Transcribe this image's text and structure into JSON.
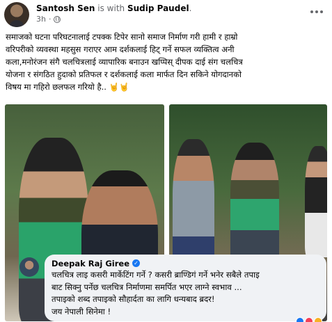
{
  "post": {
    "author": "Santosh Sen",
    "with_text": " is with ",
    "tagged": "Sudip Paudel",
    "period": ".",
    "time": "3h",
    "dot": "·",
    "text_lines": [
      "समाजको घटना परिघटनालाई टपक्क टिपेर सानो समाज निर्माण गरी हामी र हाम्रो",
      "वरिपरीको व्यवस्था महसुस गराएर आम दर्शकलाई हिट् गर्ने सफल व्यक्तित्व अनी",
      "कला,मनोरंजन संगै चलचित्रलाई व्यापारिक बनाउन खप्पिस् दीपक दाई संग चलचित्र",
      "योजना र संगठित हुदाको प्रतिफल र दर्शकलाई कला मार्फत दिन सकिने योगदानको",
      "विषय मा गहिरो छलफल गरियो है.."
    ],
    "emoji": "🤘🤘"
  },
  "comment": {
    "author": "Deepak Raj Giree",
    "verified_mark": "✓",
    "lines": [
      "चलचित्र लाइ कसरी मार्केटिंग गर्ने ? कसरी ब्राण्डिगं गर्ने भनेर सबैले तपाइ",
      "बाट सिक्नु पर्नेछ चलचित्र निर्माणमा समर्पित भएर लाग्ने स्वभाव ...",
      "तपाइको शब्द तपाइको सौहार्दता का लागि धन्यबाद ब्रदर!",
      "जय नेपाली सिनेमा !"
    ]
  },
  "colors": {
    "link": "#1877f2",
    "secondary": "#65676b",
    "bubble": "#f0f2f5"
  }
}
